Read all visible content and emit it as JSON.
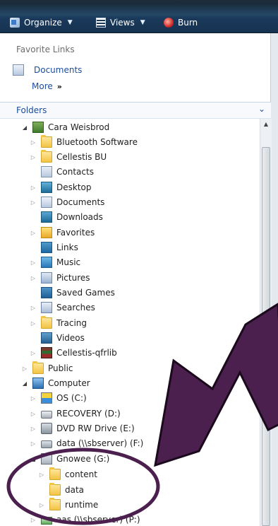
{
  "toolbar": {
    "organize": "Organize",
    "views": "Views",
    "burn": "Burn"
  },
  "favorites": {
    "title": "Favorite Links",
    "documents": "Documents",
    "more": "More",
    "more_chevron": "»"
  },
  "folders": {
    "title": "Folders",
    "collapse_chevron": "⌄"
  },
  "tree": {
    "user": "Cara Weisbrod",
    "items": [
      "Bluetooth Software",
      "Cellestis BU",
      "Contacts",
      "Desktop",
      "Documents",
      "Downloads",
      "Favorites",
      "Links",
      "Music",
      "Pictures",
      "Saved Games",
      "Searches",
      "Tracing",
      "Videos",
      "Cellestis-qfrlib"
    ],
    "public": "Public",
    "computer": "Computer",
    "drives": [
      "OS (C:)",
      "RECOVERY (D:)",
      "DVD RW Drive (E:)",
      "data (\\\\sbserver) (F:)",
      "Gnowee (G:)"
    ],
    "gnowee_children": [
      "content",
      "data",
      "runtime"
    ],
    "last": "aas (\\\\sbserver) (P:)"
  },
  "colors": {
    "accent": "#1a4d9c",
    "annotation": "#4b1f4e"
  }
}
